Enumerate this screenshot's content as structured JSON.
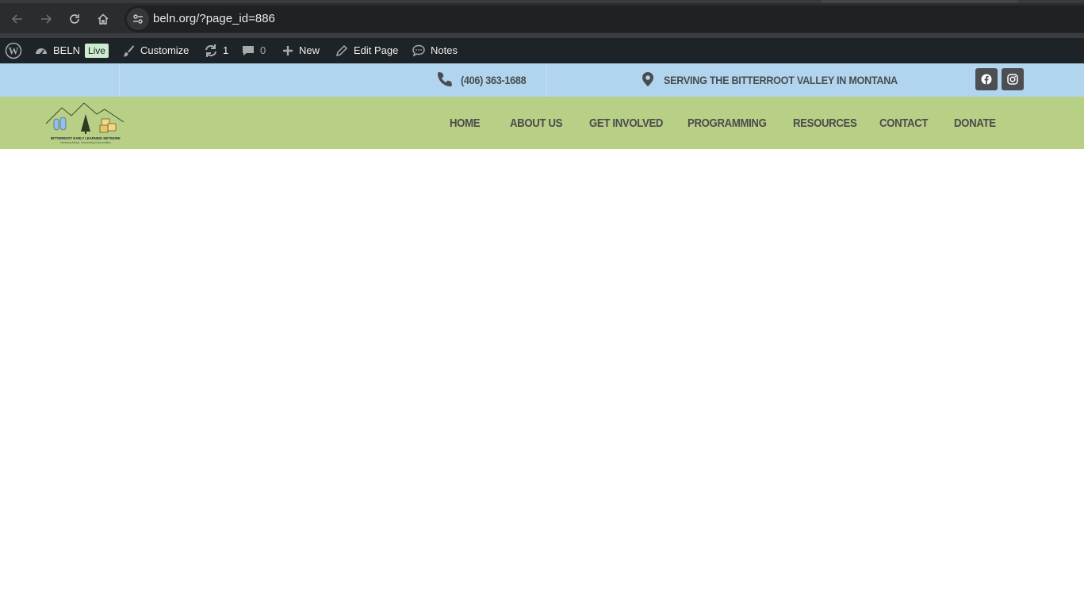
{
  "browser": {
    "url": "beln.org/?page_id=886",
    "icons": [
      "back-arrow-icon",
      "forward-arrow-icon",
      "reload-icon",
      "home-icon",
      "site-settings-icon"
    ]
  },
  "admin_bar": {
    "site_name": "BELN",
    "live_badge": "Live",
    "customize": "Customize",
    "updates_count": "1",
    "comments_count": "0",
    "new_label": "New",
    "edit_page": "Edit Page",
    "notes": "Notes"
  },
  "top_info": {
    "phone": "(406) 363-1688",
    "location": "SERVING THE BITTERROOT VALLEY IN MONTANA",
    "socials": [
      "facebook-icon",
      "instagram-icon"
    ]
  },
  "logo": {
    "title": "BITTERROOT EARLY LEARNING NETWORK",
    "tagline": "Nurturing Minds, Connecting Communities"
  },
  "nav": {
    "items": [
      "HOME",
      "ABOUT US",
      "GET INVOLVED",
      "PROGRAMMING",
      "RESOURCES",
      "CONTACT",
      "DONATE"
    ]
  },
  "colors": {
    "top_info_bg": "#b1d5ef",
    "nav_bg": "#b8cf86",
    "admin_bar_bg": "#1d2327",
    "browser_bg": "#2b2c2f"
  }
}
